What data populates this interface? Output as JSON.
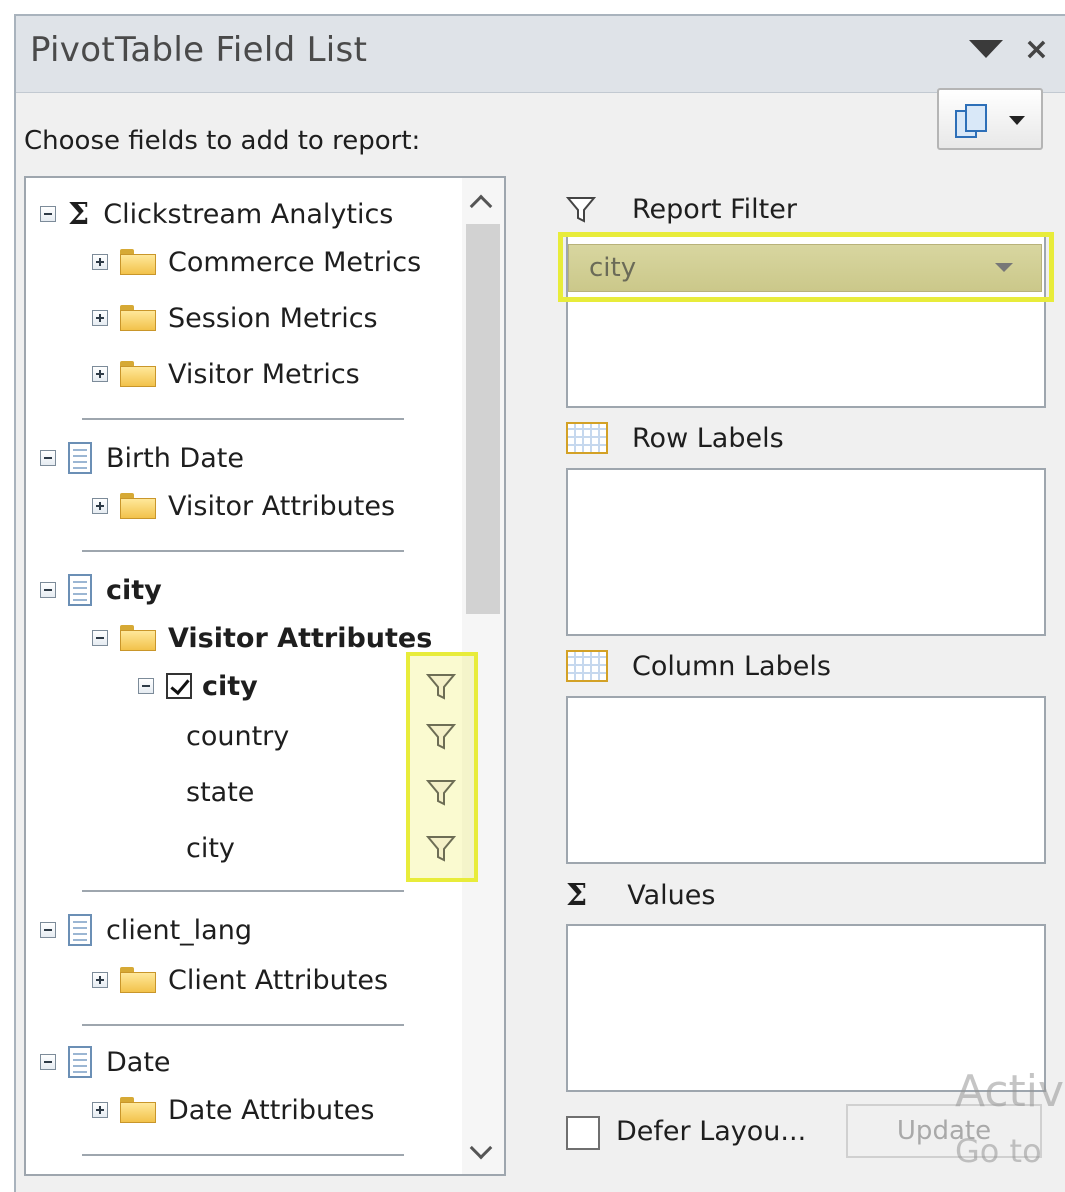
{
  "panel": {
    "title": "PivotTable Field List",
    "dropdown_icon": "triangle-down-icon",
    "close_label": "×"
  },
  "choose_label": "Choose fields to add to report:",
  "field_tree": {
    "clickstream": {
      "label": "Clickstream Analytics",
      "children": [
        "Commerce Metrics",
        "Session Metrics",
        "Visitor Metrics"
      ]
    },
    "birth_date": {
      "label": "Birth Date",
      "children": [
        "Visitor Attributes"
      ]
    },
    "city_dim": {
      "label": "city",
      "folder": "Visitor Attributes",
      "hierarchy": "city",
      "levels": [
        "country",
        "state",
        "city"
      ]
    },
    "client_lang": {
      "label": "client_lang",
      "children": [
        "Client Attributes"
      ]
    },
    "date": {
      "label": "Date",
      "children": [
        "Date Attributes"
      ]
    }
  },
  "areas": {
    "report_filter": {
      "label": "Report Filter",
      "chip": "city"
    },
    "row_labels": {
      "label": "Row Labels"
    },
    "column_labels": {
      "label": "Column Labels"
    },
    "values": {
      "label": "Values"
    }
  },
  "defer_label": "Defer Layou...",
  "update_label": "Update",
  "watermark": {
    "line1": "Activ",
    "line2": "Go to"
  },
  "colors": {
    "highlight": "#e8ec3a",
    "title_bg": "#dfe3e8"
  }
}
